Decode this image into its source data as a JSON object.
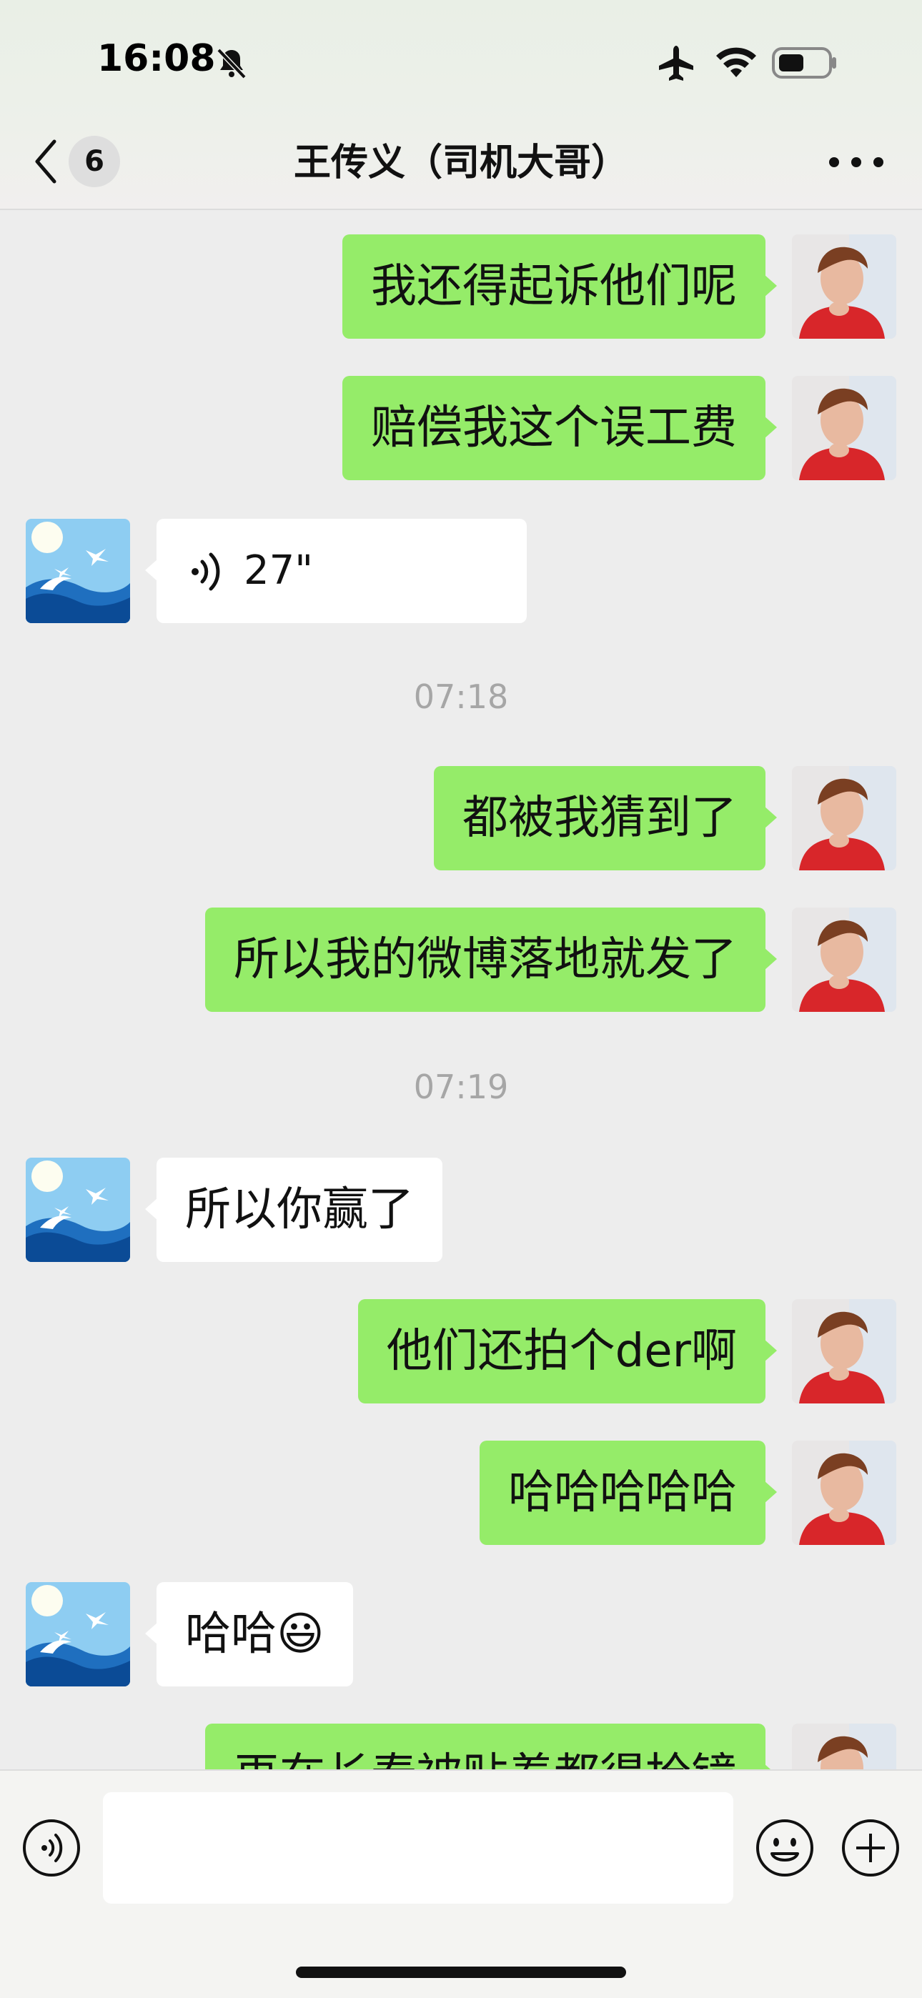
{
  "status_bar": {
    "time": "16:08"
  },
  "header": {
    "back_count": "6",
    "title": "王传义（司机大哥）"
  },
  "messages": [
    {
      "from": "me",
      "text": "我还得起诉他们呢"
    },
    {
      "from": "me",
      "text": "赔偿我这个误工费"
    },
    {
      "from": "them",
      "type": "voice",
      "duration": "27\""
    },
    {
      "timestamp": "07:18"
    },
    {
      "from": "me",
      "text": "都被我猜到了"
    },
    {
      "from": "me",
      "text": "所以我的微博落地就发了"
    },
    {
      "timestamp": "07:19"
    },
    {
      "from": "them",
      "text": "所以你赢了"
    },
    {
      "from": "me",
      "text": "他们还拍个der啊"
    },
    {
      "from": "me",
      "text": "哈哈哈哈哈"
    },
    {
      "from": "them",
      "text": "哈哈😃"
    },
    {
      "from": "me",
      "text": "再在长春被贴着都得抢镜"
    }
  ],
  "input_bar": {
    "voice_button": "voice-icon",
    "emoji_button": "emoji-icon",
    "plus_button": "plus-icon",
    "text_value": ""
  },
  "colors": {
    "my_bubble": "#95ec69",
    "their_bubble": "#ffffff",
    "background": "#ededed"
  }
}
